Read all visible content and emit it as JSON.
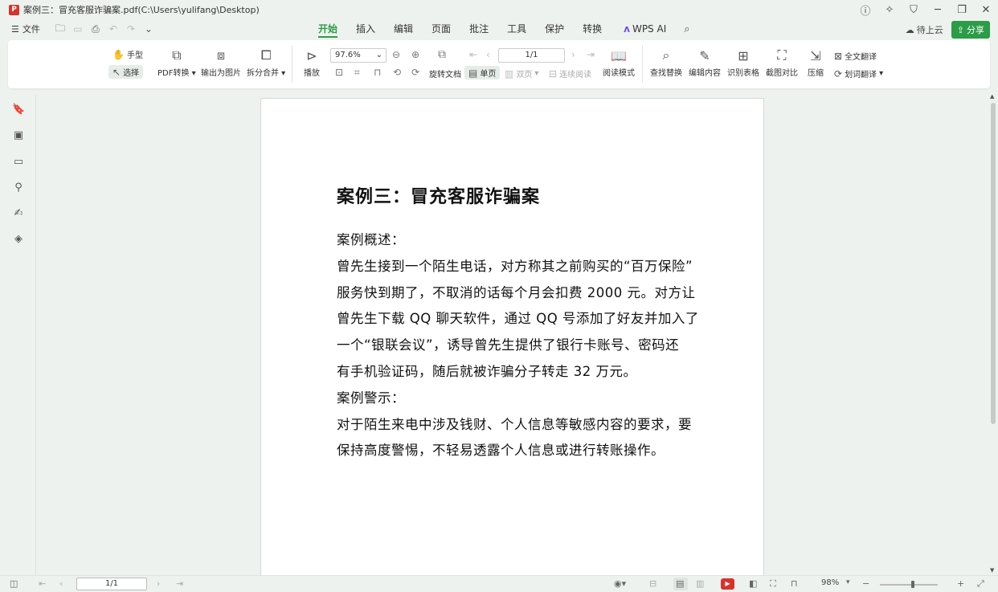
{
  "window": {
    "title": "案例三：冒充客服诈骗案.pdf(C:\\Users\\yulifang\\Desktop)",
    "app_logo": "P"
  },
  "menu": {
    "file": "文件",
    "tabs": [
      "开始",
      "插入",
      "编辑",
      "页面",
      "批注",
      "工具",
      "保护",
      "转换"
    ],
    "active_tab": "开始",
    "wps_ai": "WPS AI",
    "cloud": "待上云",
    "share": "分享"
  },
  "ribbon": {
    "hand": "手型",
    "select": "选择",
    "pdf_convert": "PDF转换",
    "export_image": "输出为图片",
    "split_merge": "拆分合并",
    "play": "播放",
    "zoom": "97.6%",
    "page": "1/1",
    "rotate": "旋转文档",
    "single_page": "单页",
    "double_page": "双页",
    "continuous": "连续阅读",
    "read_mode": "阅读模式",
    "find_replace": "查找替换",
    "edit_content": "编辑内容",
    "recognize_table": "识别表格",
    "screenshot_compare": "截图对比",
    "compress": "压缩",
    "full_translate": "全文翻译",
    "word_translate": "划词翻译"
  },
  "document": {
    "title": "案例三：冒充客服诈骗案",
    "lines": [
      "案例概述：",
      "曾先生接到一个陌生电话，对方称其之前购买的“百万保险”",
      "服务快到期了，不取消的话每个月会扣费 2000 元。对方让",
      "曾先生下载 QQ 聊天软件，通过 QQ 号添加了好友并加入了",
      "一个“银联会议”，诱导曾先生提供了银行卡账号、密码还",
      "有手机验证码，随后就被诈骗分子转走 32 万元。",
      "案例警示：",
      "对于陌生来电中涉及钱财、个人信息等敏感内容的要求，要",
      "保持高度警惕，不轻易透露个人信息或进行转账操作。"
    ]
  },
  "statusbar": {
    "page": "1/1",
    "zoom": "98%"
  },
  "colors": {
    "accent": "#2b9c47",
    "brand_red": "#d9322b",
    "background": "#eef2ef"
  }
}
